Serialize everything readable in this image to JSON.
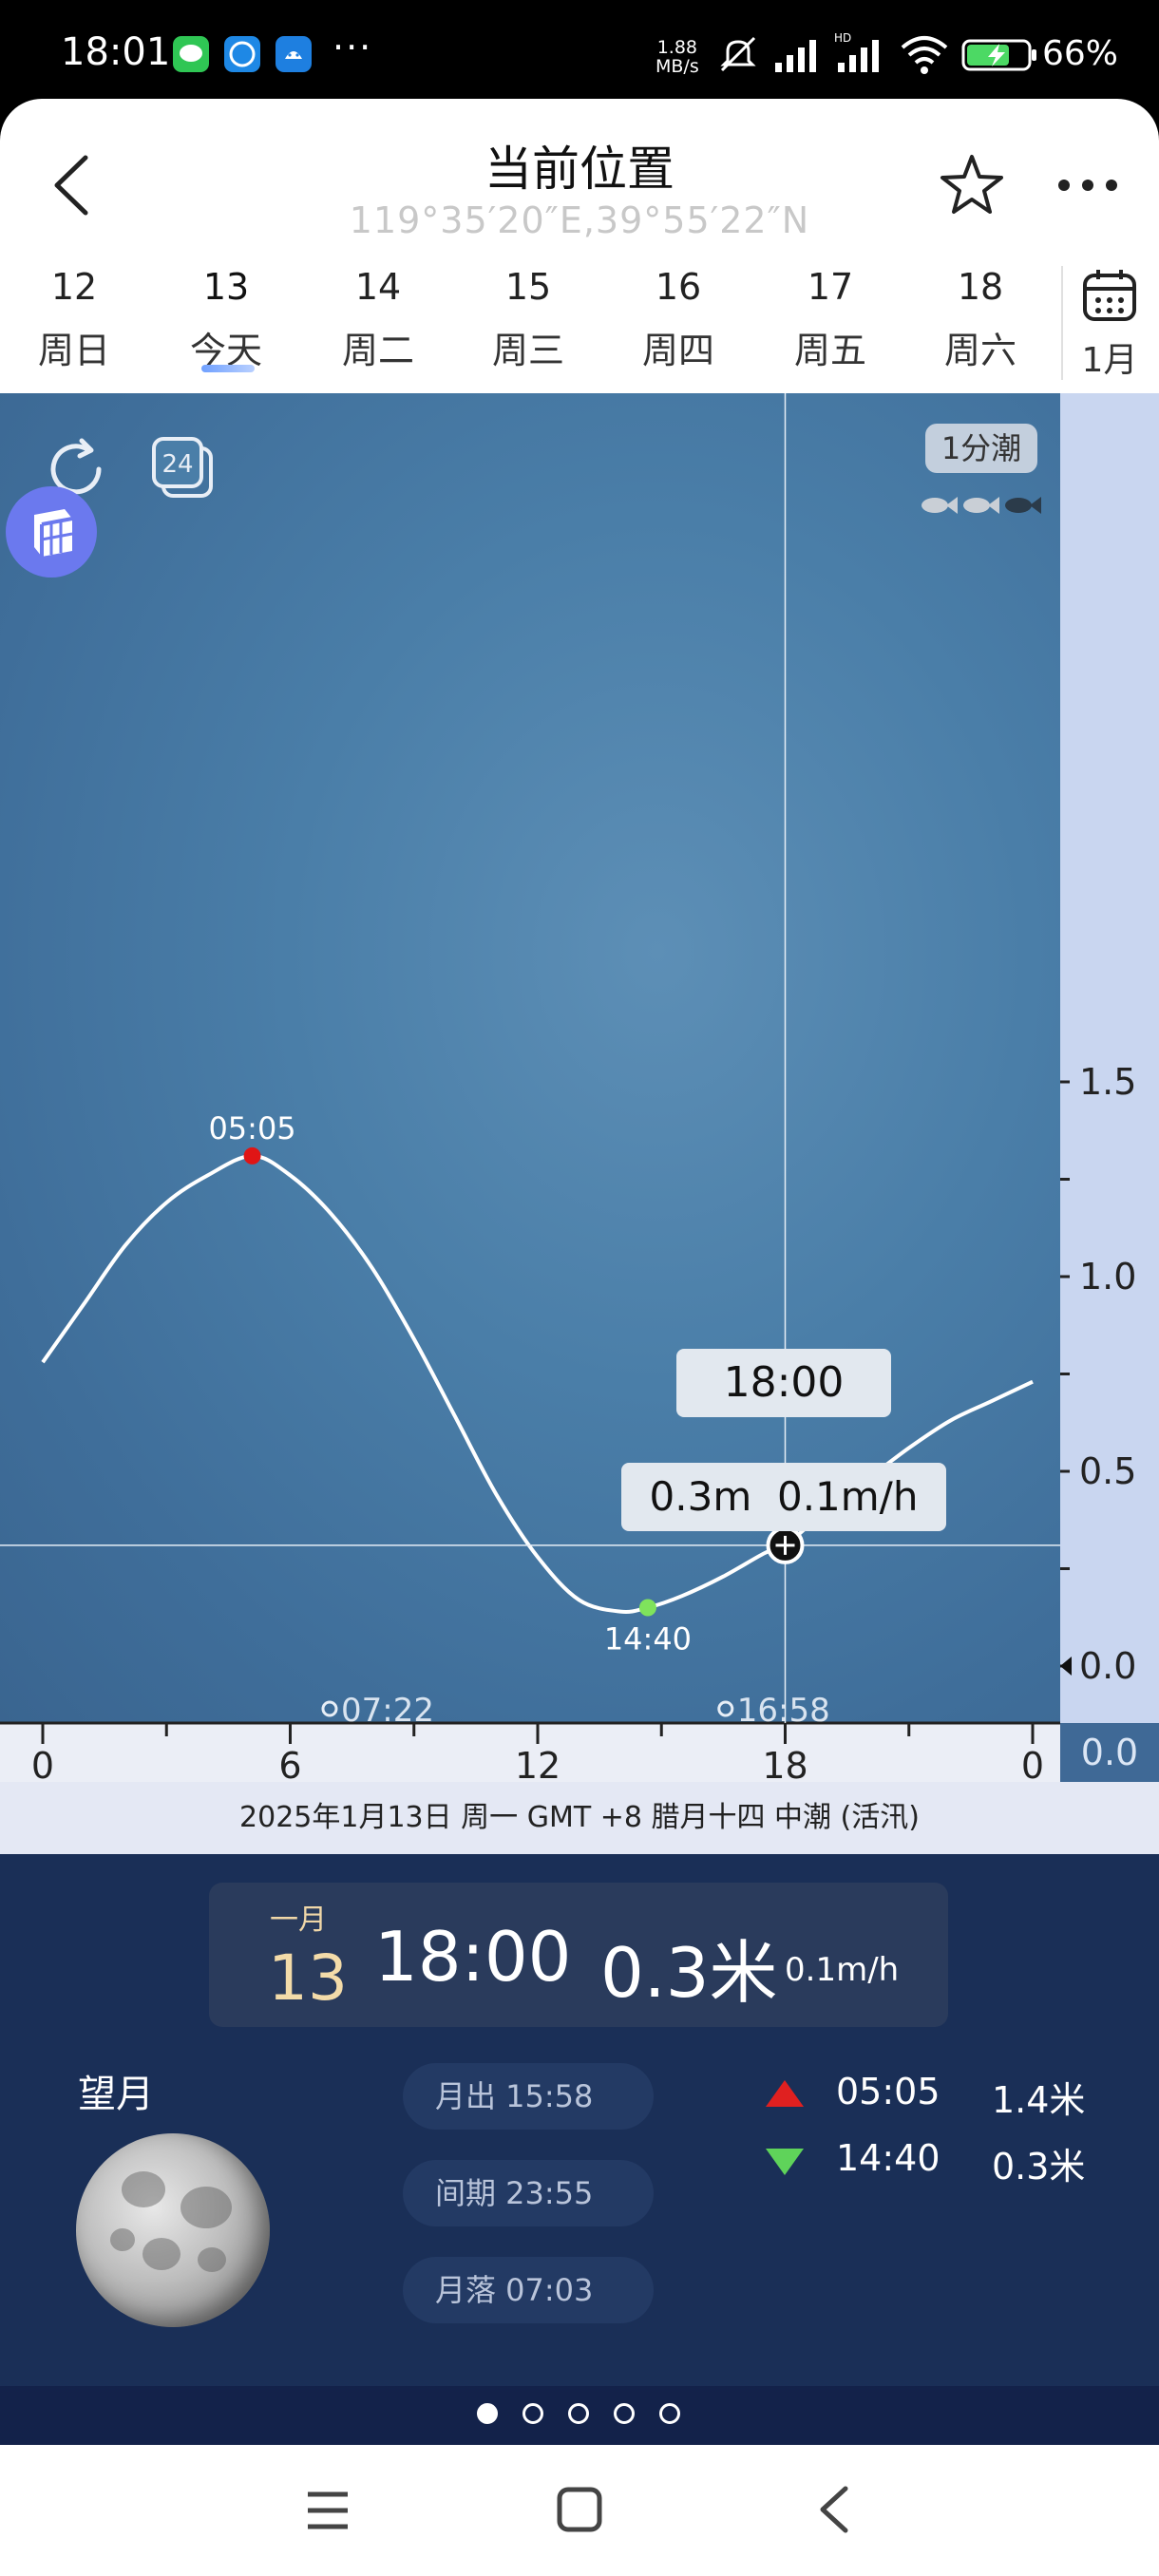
{
  "status_bar": {
    "time": "18:01",
    "net_speed_value": "1.88",
    "net_speed_unit": "MB/s",
    "battery": "66%"
  },
  "header": {
    "title": "当前位置",
    "coordinates": "119°35′20″E,39°55′22″N"
  },
  "date_tabs": [
    {
      "day": "12",
      "label": "周日",
      "active": false
    },
    {
      "day": "13",
      "label": "今天",
      "active": true
    },
    {
      "day": "14",
      "label": "周二",
      "active": false
    },
    {
      "day": "15",
      "label": "周三",
      "active": false
    },
    {
      "day": "16",
      "label": "周四",
      "active": false
    },
    {
      "day": "17",
      "label": "周五",
      "active": false
    },
    {
      "day": "18",
      "label": "周六",
      "active": false
    }
  ],
  "month_label": "1月",
  "chart_controls": {
    "mode_label": "24",
    "tide_badge": "1分潮"
  },
  "chart_data": {
    "type": "line",
    "x_ticks": [
      "0",
      "6",
      "12",
      "18",
      "0"
    ],
    "y_ticks": [
      "1.5",
      "1.0",
      "0.5",
      "0.0"
    ],
    "xlim": [
      0,
      24
    ],
    "ylim": [
      0,
      1.65
    ],
    "series": [
      {
        "x": [
          0,
          1,
          2,
          3,
          4,
          5.08,
          6,
          7,
          8,
          9,
          10,
          11,
          12,
          13,
          14,
          14.67,
          15.5,
          16.5,
          17.5,
          18,
          19,
          20,
          21,
          22,
          23,
          24
        ],
        "values": [
          0.78,
          0.93,
          1.08,
          1.19,
          1.26,
          1.31,
          1.26,
          1.16,
          1.02,
          0.84,
          0.64,
          0.44,
          0.28,
          0.17,
          0.14,
          0.15,
          0.18,
          0.23,
          0.29,
          0.31,
          0.4,
          0.48,
          0.56,
          0.63,
          0.68,
          0.73
        ]
      }
    ],
    "high_tide": {
      "time": "05:05",
      "x": 5.08,
      "value": 1.31
    },
    "low_tide": {
      "time": "14:40",
      "x": 14.67,
      "value": 0.15
    },
    "cursor": {
      "time": "18:00",
      "x": 18,
      "value": 0.31,
      "height_label": "0.3m",
      "rate_label": "0.1m/h"
    },
    "sunrise": {
      "time": "07:22",
      "x": 7.37
    },
    "sunset": {
      "time": "16:58",
      "x": 16.97
    },
    "axis_right_zero": "0.0"
  },
  "info_strip": "2025年1月13日  周一  GMT +8  腊月十四  中潮 (活汛)",
  "detail": {
    "month": "一月",
    "day": "13",
    "time": "18:00",
    "height": "0.3米",
    "rate": "0.1m/h"
  },
  "moon": {
    "phase": "望月",
    "moonrise": "月出 15:58",
    "interval": "间期 23:55",
    "moonset": "月落 07:03"
  },
  "tide_list": [
    {
      "type": "high",
      "time": "05:05",
      "height": "1.4米",
      "color": "#e02020"
    },
    {
      "type": "low",
      "time": "14:40",
      "height": "0.3米",
      "color": "#5fd35a"
    }
  ],
  "pager": {
    "count": 5,
    "active": 0
  }
}
